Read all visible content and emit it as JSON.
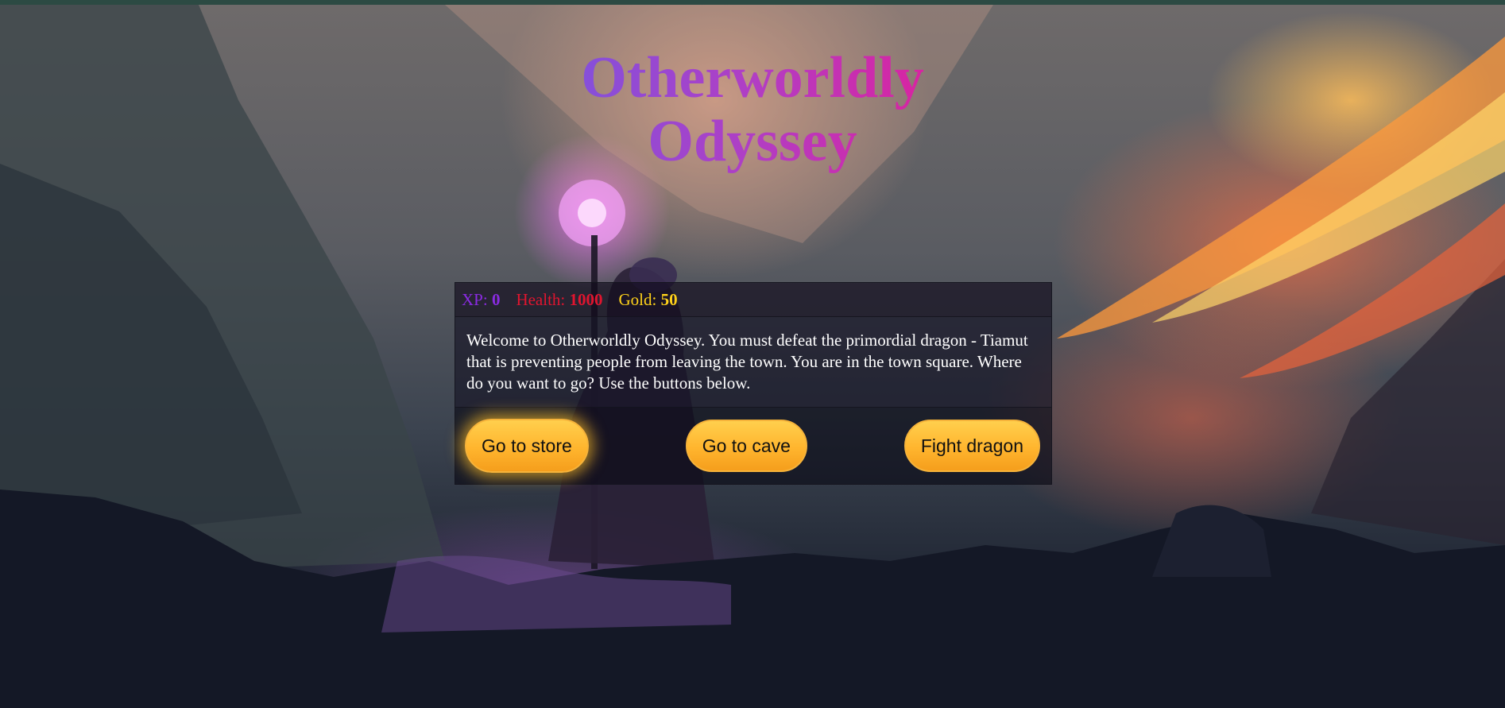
{
  "title": "Otherworldly Odyssey",
  "stats": {
    "xp_label": "XP:",
    "xp_value": "0",
    "health_label": "Health:",
    "health_value": "1000",
    "gold_label": "Gold:",
    "gold_value": "50"
  },
  "text": "Welcome to Otherworldly Odyssey. You must defeat the primordial dragon - Tiamut that is preventing people from leaving the town. You are in the town square. Where do you want to go? Use the buttons below.",
  "buttons": {
    "button1": "Go to store",
    "button2": "Go to cave",
    "button3": "Fight dragon"
  },
  "colors": {
    "xp": "#8a2be2",
    "health": "#e0152f",
    "gold": "#ffd21a",
    "button": "#ffb52e",
    "title_gradient_start": "#6b5ae8",
    "title_gradient_end": "#f0148c"
  }
}
